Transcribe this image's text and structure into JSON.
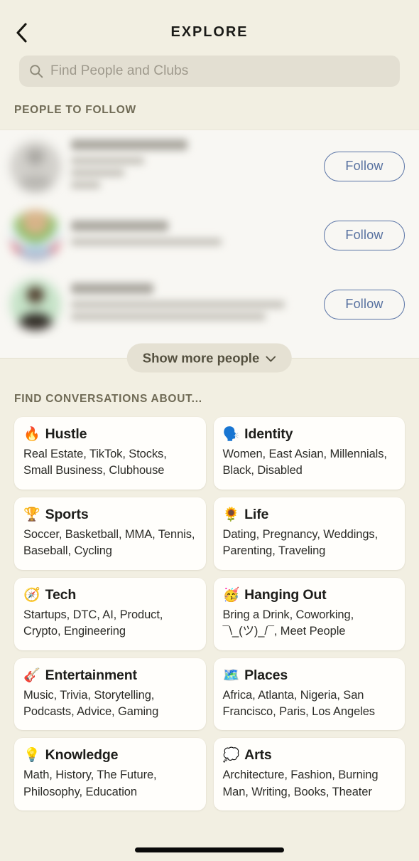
{
  "header": {
    "title": "EXPLORE",
    "back_icon": "chevron-left-icon"
  },
  "search": {
    "placeholder": "Find People and Clubs",
    "value": "",
    "icon": "search-icon"
  },
  "people": {
    "section_label": "PEOPLE TO FOLLOW",
    "follow_label": "Follow",
    "show_more_label": "Show more people",
    "show_more_icon": "chevron-down-icon",
    "rows": [
      {
        "avatar_style": "gray-placeholder",
        "avatar_color": "#c9c7c2",
        "lines": 3,
        "name_width": "48%",
        "line_widths": [
          "30%",
          "22%",
          "12%"
        ]
      },
      {
        "avatar_style": "colorful-photo",
        "avatar_color": "#e0a9ae",
        "lines": 2,
        "name_width": "40%",
        "line_widths": [
          "62%"
        ]
      },
      {
        "avatar_style": "green-ring-photo",
        "avatar_color": "#bfe0c3",
        "lines": 3,
        "name_width": "34%",
        "line_widths": [
          "88%",
          "80%"
        ]
      }
    ]
  },
  "conversations": {
    "section_label": "FIND CONVERSATIONS ABOUT...",
    "cards": [
      {
        "emoji": "🔥",
        "icon_name": "fire-emoji",
        "title": "Hustle",
        "tags": "Real Estate, TikTok, Stocks, Small Business, Clubhouse"
      },
      {
        "emoji": "🗣️",
        "icon_name": "speaking-head-emoji",
        "title": "Identity",
        "tags": "Women, East Asian, Millennials, Black, Disabled"
      },
      {
        "emoji": "🏆",
        "icon_name": "trophy-emoji",
        "title": "Sports",
        "tags": "Soccer, Basketball, MMA, Tennis, Baseball, Cycling"
      },
      {
        "emoji": "🌻",
        "icon_name": "sunflower-emoji",
        "title": "Life",
        "tags": "Dating, Pregnancy, Weddings, Parenting, Traveling"
      },
      {
        "emoji": "🧭",
        "icon_name": "compass-emoji",
        "title": "Tech",
        "tags": "Startups, DTC, AI, Product, Crypto, Engineering"
      },
      {
        "emoji": "🥳",
        "icon_name": "partying-face-emoji",
        "title": "Hanging Out",
        "tags": "Bring a Drink, Coworking, ¯\\_(ツ)_/¯, Meet People"
      },
      {
        "emoji": "🎸",
        "icon_name": "guitar-emoji",
        "title": "Entertainment",
        "tags": "Music, Trivia, Storytelling, Podcasts, Advice, Gaming"
      },
      {
        "emoji": "🗺️",
        "icon_name": "world-map-emoji",
        "title": "Places",
        "tags": "Africa, Atlanta, Nigeria, San Francisco, Paris, Los Angeles"
      },
      {
        "emoji": "💡",
        "icon_name": "light-bulb-emoji",
        "title": "Knowledge",
        "tags": "Math, History, The Future, Philosophy, Education"
      },
      {
        "emoji": "💭",
        "icon_name": "thought-balloon-emoji",
        "title": "Arts",
        "tags": "Architecture, Fashion, Burning Man, Writing, Books, Theater"
      }
    ]
  },
  "colors": {
    "background": "#f2efe2",
    "people_section_background": "#f8f7f3",
    "card_background": "#fffefb",
    "section_label": "#6f6a55",
    "follow_accent": "#56709f",
    "search_field": "#e3dfd2",
    "pill": "#e5e1d3",
    "title": "#1b1b18"
  }
}
